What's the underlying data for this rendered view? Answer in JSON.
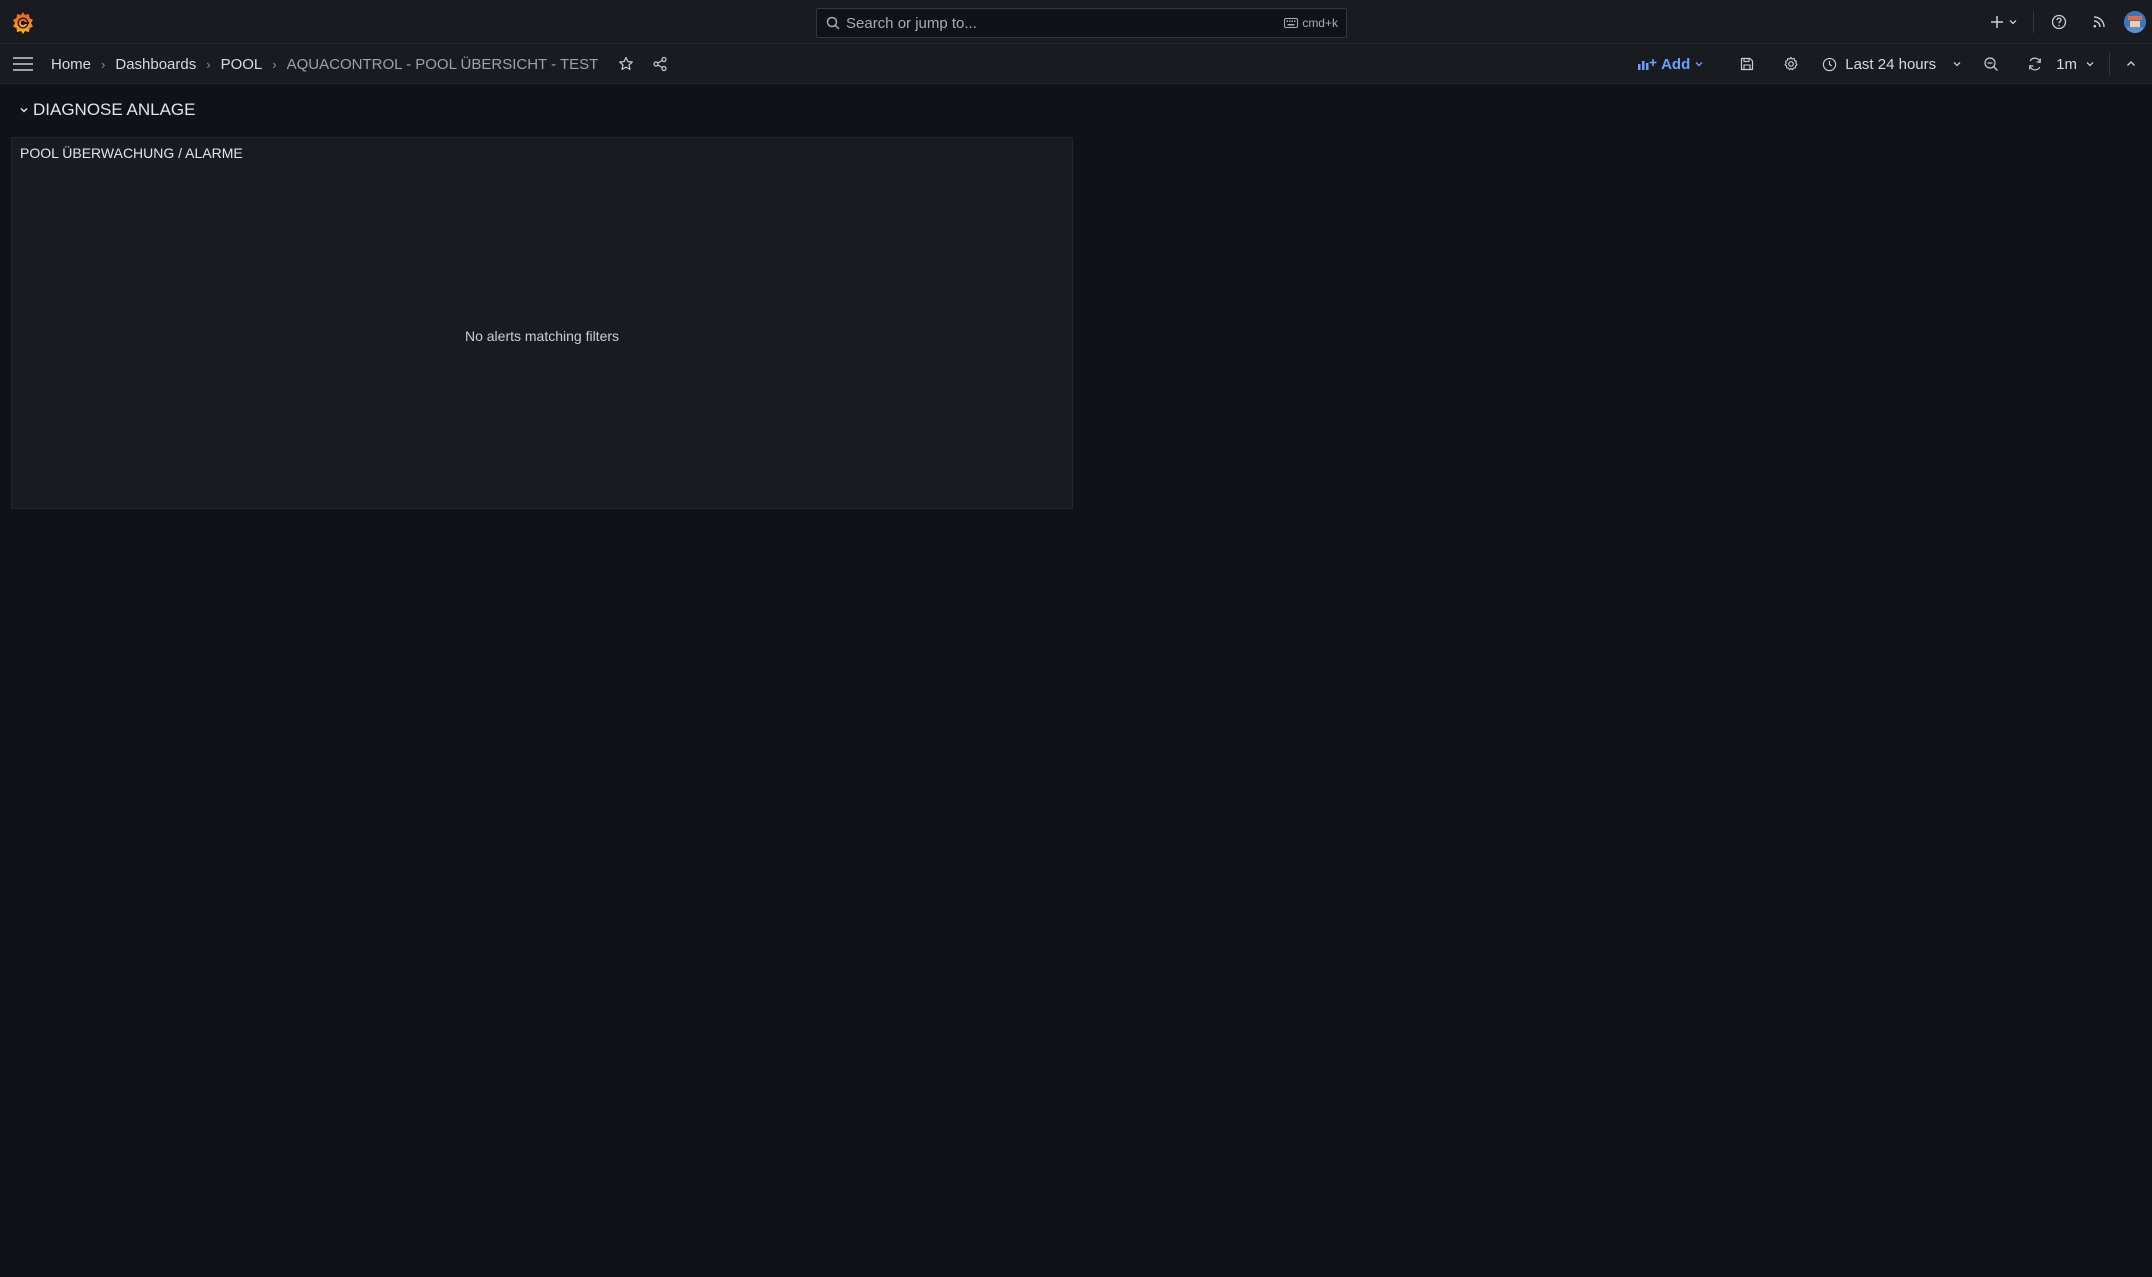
{
  "search": {
    "placeholder": "Search or jump to...",
    "shortcut": "cmd+k"
  },
  "breadcrumb": {
    "items": [
      "Home",
      "Dashboards",
      "POOL"
    ],
    "current": "AQUACONTROL - POOL ÜBERSICHT - TEST"
  },
  "toolbar": {
    "add_label": "Add",
    "time_range": "Last 24 hours",
    "refresh_interval": "1m"
  },
  "row": {
    "title": "DIAGNOSE ANLAGE"
  },
  "panel": {
    "title": "POOL ÜBERWACHUNG / ALARME",
    "empty_message": "No alerts matching filters"
  },
  "colors": {
    "background": "#111217",
    "bar": "#181b1f",
    "accent": "#6e9fff",
    "logo_orange": "#f46800"
  }
}
